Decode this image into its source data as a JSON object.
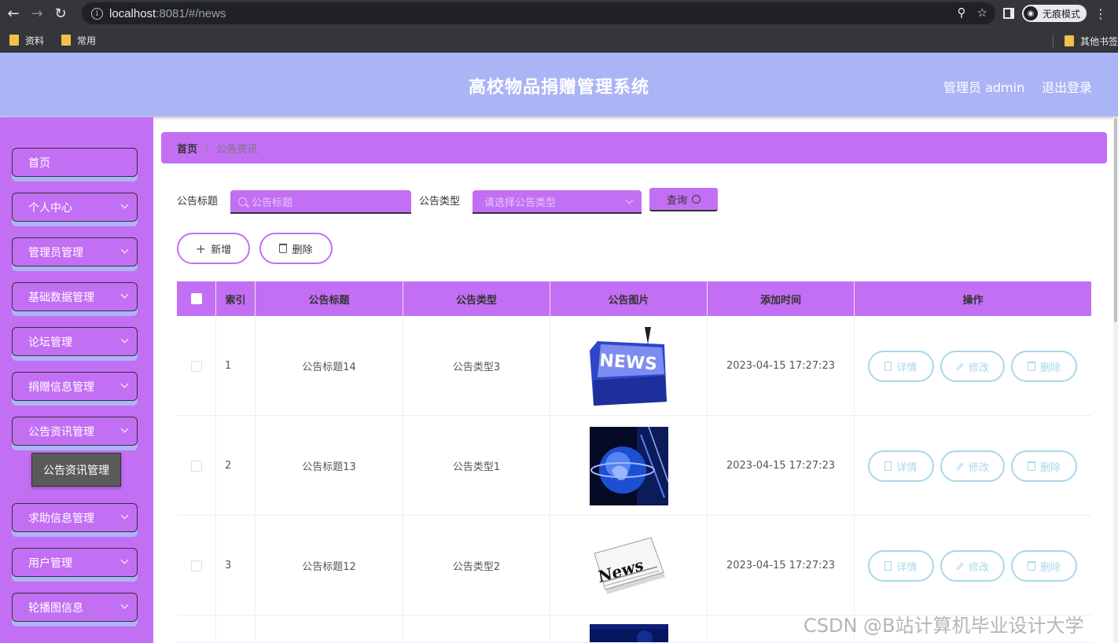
{
  "browser": {
    "url_host": "localhost",
    "url_rest": ":8081/#/news",
    "incognito_label": "无痕模式",
    "bookmarks": [
      "资料",
      "常用"
    ],
    "other_bookmarks": "其他书签"
  },
  "header": {
    "title": "高校物品捐赠管理系统",
    "user": "管理员 admin",
    "logout": "退出登录"
  },
  "sidebar": {
    "items": [
      {
        "label": "首页",
        "expandable": false
      },
      {
        "label": "个人中心",
        "expandable": true
      },
      {
        "label": "管理员管理",
        "expandable": true
      },
      {
        "label": "基础数据管理",
        "expandable": true
      },
      {
        "label": "论坛管理",
        "expandable": true
      },
      {
        "label": "捐赠信息管理",
        "expandable": true
      },
      {
        "label": "公告资讯管理",
        "expandable": true
      },
      {
        "label": "求助信息管理",
        "expandable": true
      },
      {
        "label": "用户管理",
        "expandable": true
      },
      {
        "label": "轮播图信息",
        "expandable": true
      }
    ],
    "submenu_active": "公告资讯管理"
  },
  "breadcrumb": {
    "home": "首页",
    "separator": "/",
    "current": "公告资讯"
  },
  "filters": {
    "title_label": "公告标题",
    "title_placeholder": "公告标题",
    "type_label": "公告类型",
    "type_placeholder": "请选择公告类型",
    "query_button": "查询"
  },
  "actions": {
    "add": "新增",
    "delete": "删除"
  },
  "table": {
    "columns": [
      "索引",
      "公告标题",
      "公告类型",
      "公告图片",
      "添加时间",
      "操作"
    ],
    "row_actions": [
      "详情",
      "修改",
      "删除"
    ],
    "rows": [
      {
        "index": "1",
        "title": "公告标题14",
        "type": "公告类型3",
        "image": "news-keyboard-key",
        "time": "2023-04-15 17:27:23"
      },
      {
        "index": "2",
        "title": "公告标题13",
        "type": "公告类型1",
        "image": "globe-broadcast",
        "time": "2023-04-15 17:27:23"
      },
      {
        "index": "3",
        "title": "公告标题12",
        "type": "公告类型2",
        "image": "newspaper",
        "time": "2023-04-15 17:27:23"
      },
      {
        "index": "",
        "title": "",
        "type": "",
        "image": "blue-news-partial",
        "time": ""
      }
    ]
  },
  "watermark": "CSDN @B站计算机毕业设计大学",
  "colors": {
    "header_bg": "#abb5f6",
    "sidebar_bg": "#c36ff4",
    "accent": "#c36ff4",
    "action_border": "#a8d8e8"
  }
}
